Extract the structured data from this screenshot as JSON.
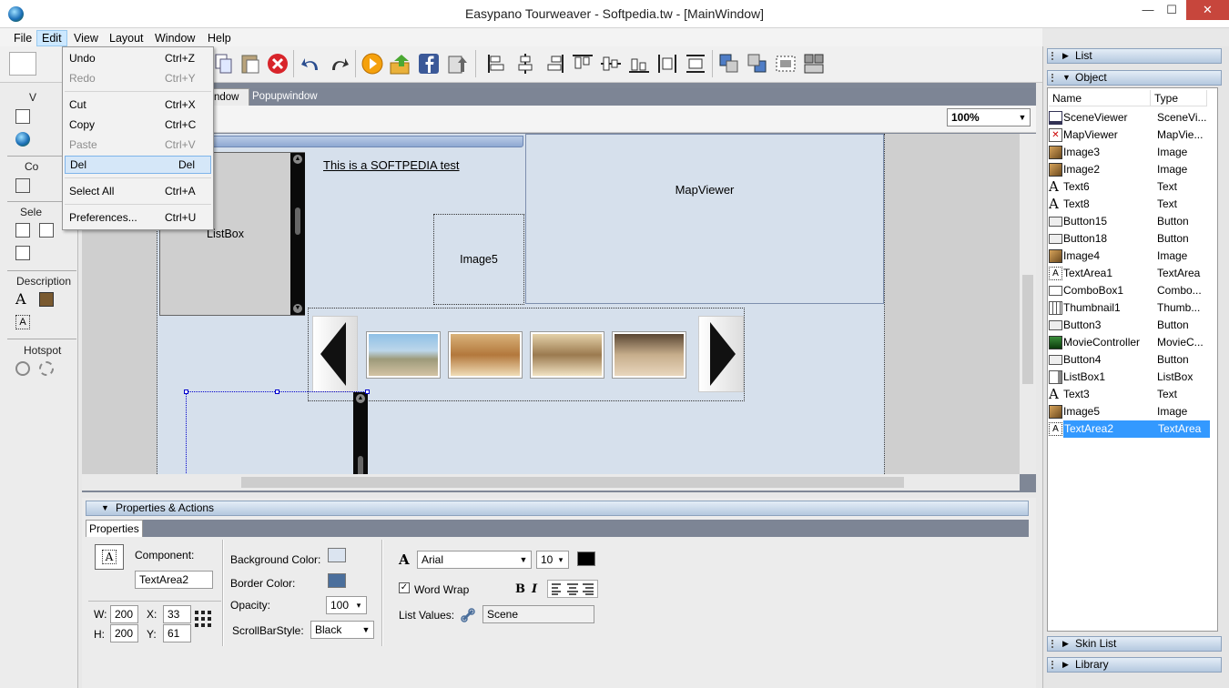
{
  "window": {
    "title": "Easypano Tourweaver - Softpedia.tw - [MainWindow]",
    "min": "—",
    "max": "☐",
    "close": "✕"
  },
  "menubar": [
    "File",
    "Edit",
    "View",
    "Layout",
    "Window",
    "Help"
  ],
  "edit_menu": [
    {
      "label": "Undo",
      "shortcut": "Ctrl+Z",
      "enabled": true
    },
    {
      "label": "Redo",
      "shortcut": "Ctrl+Y",
      "enabled": false
    },
    {
      "label": "Cut",
      "shortcut": "Ctrl+X",
      "enabled": true
    },
    {
      "label": "Copy",
      "shortcut": "Ctrl+C",
      "enabled": true
    },
    {
      "label": "Paste",
      "shortcut": "Ctrl+V",
      "enabled": false
    },
    {
      "label": "Del",
      "shortcut": "Del",
      "enabled": true
    },
    {
      "label": "Select All",
      "shortcut": "Ctrl+A",
      "enabled": true
    },
    {
      "label": "Preferences...",
      "shortcut": "Ctrl+U",
      "enabled": true
    }
  ],
  "left_panel": {
    "v_head": "V",
    "co_head": "Co",
    "sele_head": "Sele",
    "description": "Description",
    "hotspot": "Hotspot"
  },
  "tabs": {
    "main_window_fragment": "ndow",
    "popup": "Popupwindow"
  },
  "zoom": "100%",
  "stage": {
    "text_link": "This is a SOFTPEDIA test",
    "listbox": "ListBox",
    "image5": "Image5",
    "mapviewer": "MapViewer"
  },
  "right_panel": {
    "list_header": "List",
    "object_header": "Object",
    "col_name": "Name",
    "col_type": "Type",
    "objects": [
      {
        "name": "SceneViewer",
        "type": "SceneVi...",
        "icon": "sceneviewer-icon"
      },
      {
        "name": "MapViewer",
        "type": "MapVie...",
        "icon": "mapviewer-icon"
      },
      {
        "name": "Image3",
        "type": "Image",
        "icon": "image-icon"
      },
      {
        "name": "Image2",
        "type": "Image",
        "icon": "image-icon"
      },
      {
        "name": "Text6",
        "type": "Text",
        "icon": "text-icon"
      },
      {
        "name": "Text8",
        "type": "Text",
        "icon": "text-icon"
      },
      {
        "name": "Button15",
        "type": "Button",
        "icon": "button-icon"
      },
      {
        "name": "Button18",
        "type": "Button",
        "icon": "button-icon"
      },
      {
        "name": "Image4",
        "type": "Image",
        "icon": "image-icon"
      },
      {
        "name": "TextArea1",
        "type": "TextArea",
        "icon": "textarea-icon"
      },
      {
        "name": "ComboBox1",
        "type": "Combo...",
        "icon": "combobox-icon"
      },
      {
        "name": "Thumbnail1",
        "type": "Thumb...",
        "icon": "thumbnail-icon"
      },
      {
        "name": "Button3",
        "type": "Button",
        "icon": "button-icon"
      },
      {
        "name": "MovieController",
        "type": "MovieC...",
        "icon": "moviecontroller-icon"
      },
      {
        "name": "Button4",
        "type": "Button",
        "icon": "button-icon"
      },
      {
        "name": "ListBox1",
        "type": "ListBox",
        "icon": "listbox-icon"
      },
      {
        "name": "Text3",
        "type": "Text",
        "icon": "text-icon"
      },
      {
        "name": "Image5",
        "type": "Image",
        "icon": "image-icon"
      },
      {
        "name": "TextArea2",
        "type": "TextArea",
        "icon": "textarea-icon"
      }
    ],
    "selected_index": 18,
    "skin_list": "Skin List",
    "library": "Library"
  },
  "properties": {
    "panel_title": "Properties & Actions",
    "tab": "Properties",
    "component_label": "Component:",
    "component_value": "TextArea2",
    "w_label": "W:",
    "w_value": "200",
    "h_label": "H:",
    "h_value": "200",
    "x_label": "X:",
    "x_value": "33",
    "y_label": "Y:",
    "y_value": "61",
    "bg_color_label": "Background Color:",
    "border_color_label": "Border Color:",
    "opacity_label": "Opacity:",
    "opacity_value": "100",
    "scrollbar_label": "ScrollBarStyle:",
    "scrollbar_value": "Black",
    "font_value": "Arial",
    "font_size": "10",
    "word_wrap_label": "Word Wrap",
    "word_wrap_checked": "✓",
    "list_values_label": "List Values:",
    "list_values_value": "Scene",
    "bold": "B",
    "italic": "I",
    "bg_color": "#dbe4f0",
    "border_color": "#4b6f9c",
    "text_color": "#000000"
  }
}
